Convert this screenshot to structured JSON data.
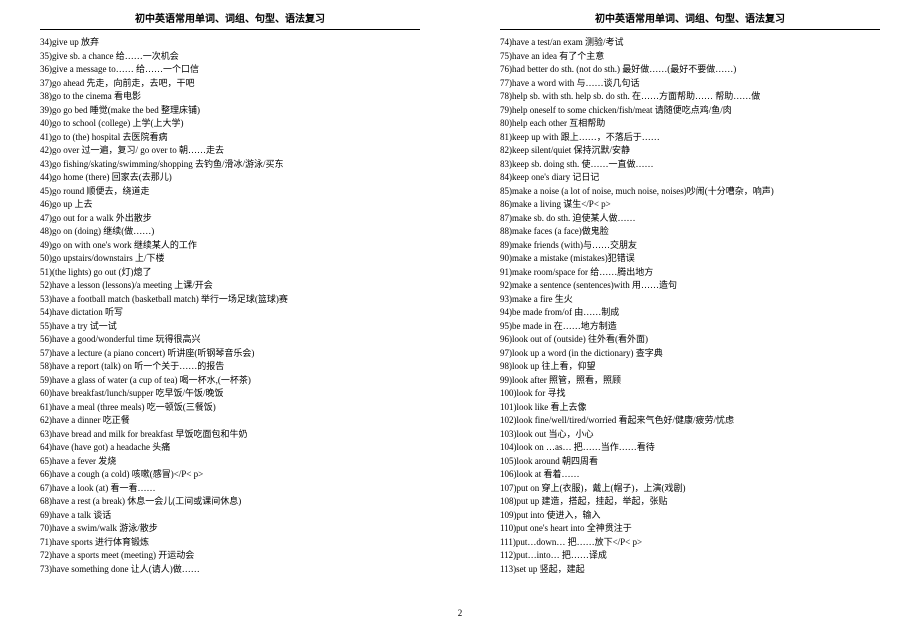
{
  "header_left": "初中英语常用单词、词组、句型、语法复习",
  "header_right": "初中英语常用单词、词组、句型、语法复习",
  "page_number": "2",
  "left": [
    "34)give up   放弃",
    "35)give sb. a chance   给……一次机会",
    "36)give a message to……   给……一个口信",
    "37)go ahead   先走，向前走，去吧，干吧",
    "38)go to the cinema   看电影",
    "39)go go bed   睡觉(make the bed 整理床铺)",
    "40)go to school (college)   上学(上大学)",
    "41)go to (the) hospital   去医院看病",
    "42)go over   过一遍，复习/   go over to   朝……走去",
    "43)go fishing/skating/swimming/shopping   去钓鱼/滑冰/游泳/买东",
    "44)go home (there)   回家去(去那儿)",
    "45)go round   顺便去，绕道走",
    "46)go up   上去",
    "47)go out for a walk   外出散步",
    "48)go on (doing)   继续(做……)",
    "49)go on with one's work   继续某人的工作",
    "50)go upstairs/downstairs   上/下楼",
    "51)(the lights) go out   (灯)熄了",
    "52)have a lesson (lessons)/a meeting   上课/开会",
    "53)have a football match (basketball match)   举行一场足球(篮球)赛",
    "54)have dictation   听写",
    "55)have a try   试一试",
    "56)have a good/wonderful time   玩得很高兴",
    "57)have a lecture (a piano concert)   听讲座(听钢琴音乐会)",
    "58)have a report (talk) on   听一个关于……的报告",
    "59)have a glass of water (a cup of tea)   喝一杯水,(一杯茶)",
    "60)have breakfast/lunch/supper   吃早饭/午饭/晚饭",
    "61)have a meal (three meals)   吃一顿饭(三餐饭)",
    "62)have a dinner 吃正餐",
    "63)have bread and milk for breakfast   早饭吃面包和牛奶",
    "64)have (have got) a headache 头痛",
    "65)have a fever 发烧",
    "66)have a cough (a cold)   咳嗽(感冒)</P< p>",
    "67)have a look (at)   看一看……",
    "68)have a rest (a break)   休息一会儿(工间或课间休息)",
    "69)have a talk  谈话",
    "70)have a swim/walk   游泳/散步",
    "71)have sports   进行体育锻炼",
    "72)have a sports meet (meeting)   开运动会",
    "73)have something done   让人(请人)做……"
  ],
  "right": [
    "74)have a test/an exam   测验/考试",
    "75)have an idea   有了个主意",
    "76)had better do sth. (not do sth.)   最好做……(最好不要做……)",
    "77)have a word with   与……谈几句话",
    "78)help sb. with sth. help sb. do sth.   在……方面帮助……   帮助……做",
    "79)help oneself to some chicken/fish/meat   请随便吃点鸡/鱼/肉",
    "80)help each other   互相帮助",
    "81)keep up with   跟上……，不落后于……",
    "82)keep silent/quiet   保持沉默/安静",
    "83)keep sb. doing sth.   使……一直做……",
    "84)keep one's diary   记日记",
    "85)make a noise (a lot of noise, much noise, noises)吵闹(十分嘈杂，响声)",
    "86)make a living   谋生</P< p>",
    "87)make sb. do sth.   迫使某人做……",
    "88)make faces (a face)做鬼脸",
    "89)make friends (with)与……交朋友",
    "90)make a mistake (mistakes)犯错误",
    "91)make room/space for   给……腾出地方",
    "92)make a sentence (sentences)with   用……造句",
    "93)make a fire   生火",
    "94)be made from/of   由……制成",
    "95)be made in   在……地方制造",
    "96)look out of (outside)   往外看(看外面)",
    "97)look up a word (in the dictionary)   查字典",
    "98)look up   往上看，仰望",
    "99)look after   照管，照看，照顾",
    "100)look for   寻找",
    "101)look like   看上去像",
    "102)look fine/well/tired/worried   看起来气色好/健康/疲劳/忧虑",
    "103)look out   当心，小心",
    "104)look on …as…   把……当作……看待",
    "105)look around   朝四周看",
    "106)look at   看着……",
    "107)put on   穿上(衣服)，戴上(帽子)，上演(戏剧)",
    "108)put up   建造，搭起，挂起，举起，张贴",
    "109)put into   使进入，输入",
    "110)put one's heart into   全神贯注于",
    "111)put…down…   把……放下</P< p>",
    "112)put…into…   把……译成",
    "113)set up   竖起，建起"
  ]
}
